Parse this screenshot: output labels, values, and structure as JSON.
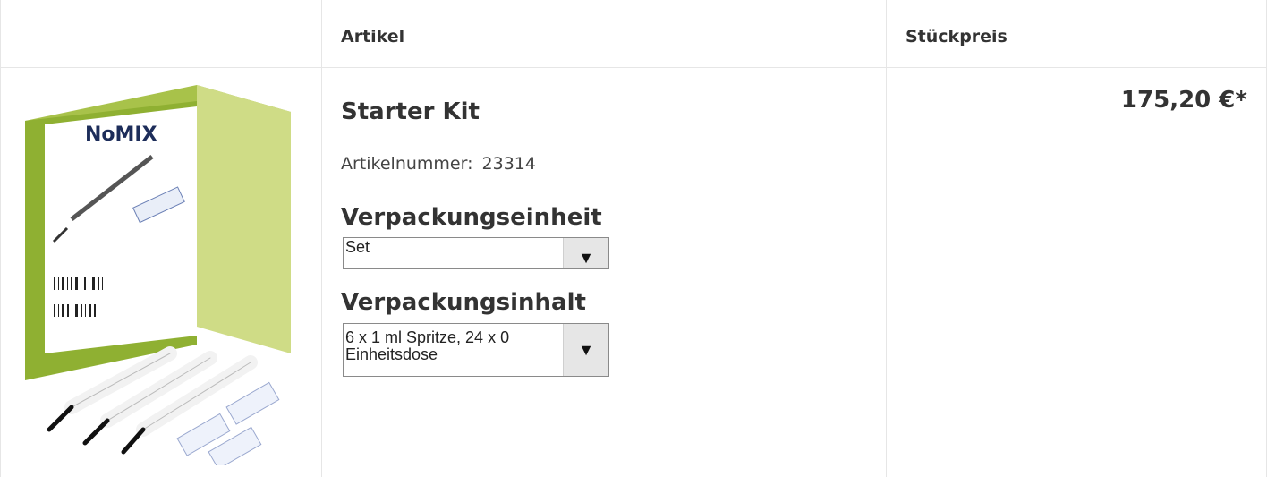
{
  "header": {
    "col_article": "Artikel",
    "col_price": "Stückpreis"
  },
  "product": {
    "title": "Starter Kit",
    "article_number_label": "Artikelnummer:",
    "article_number": "23314",
    "packaging_unit_label": "Verpackungseinheit",
    "packaging_unit_value": "Set",
    "packaging_content_label": "Verpackungsinhalt",
    "packaging_content_value": "6 x 1 ml Spritze, 24 x 0\nEinheitsdose",
    "price": "175,20 €*",
    "image_brand_text": "NoMIX"
  },
  "icons": {
    "select_arrow": "chevron-down-icon"
  }
}
